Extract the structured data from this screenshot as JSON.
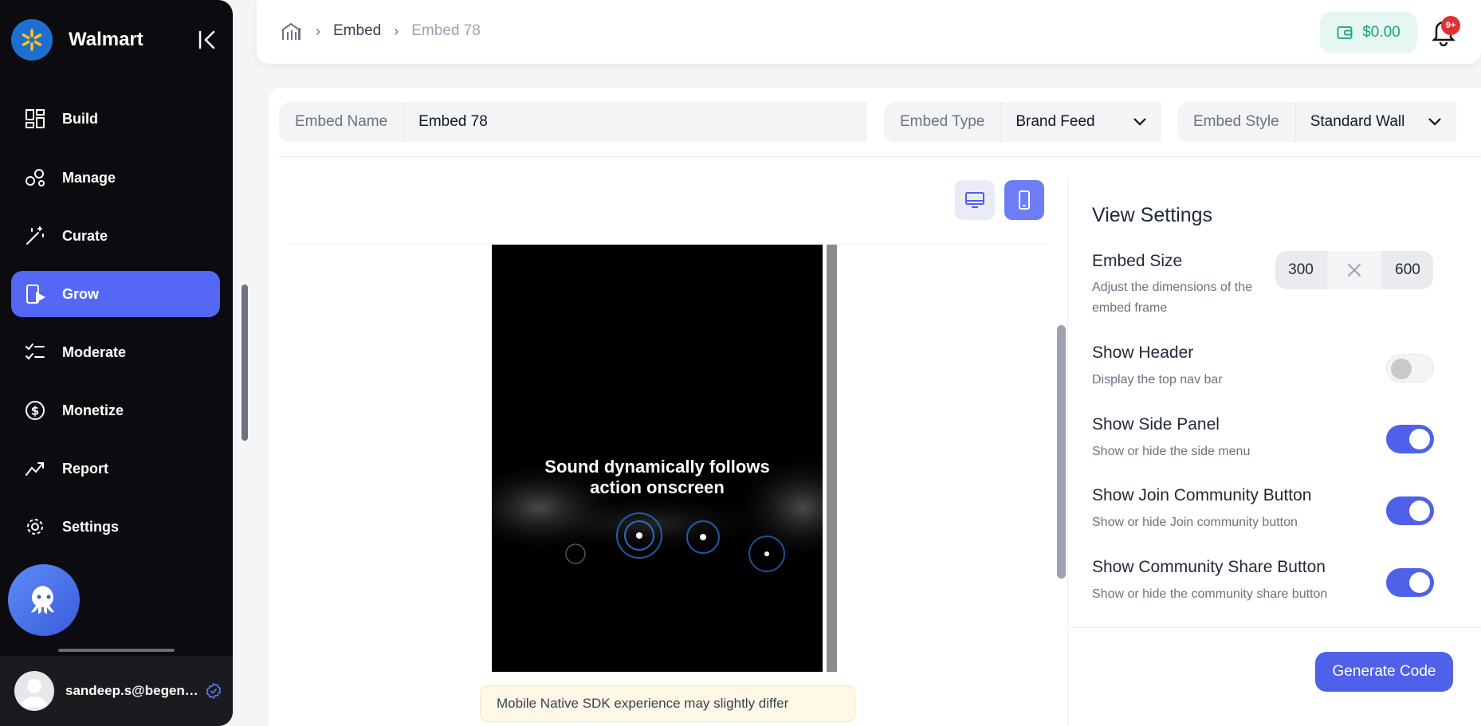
{
  "sidebar": {
    "brand": "Walmart",
    "items": [
      {
        "label": "Build",
        "icon": "grid-icon"
      },
      {
        "label": "Manage",
        "icon": "bubbles-icon"
      },
      {
        "label": "Curate",
        "icon": "magic-wand-icon"
      },
      {
        "label": "Grow",
        "icon": "mobile-play-icon",
        "active": true
      },
      {
        "label": "Moderate",
        "icon": "checklist-icon"
      },
      {
        "label": "Monetize",
        "icon": "dollar-icon"
      },
      {
        "label": "Report",
        "icon": "trend-icon"
      },
      {
        "label": "Settings",
        "icon": "gear-icon"
      }
    ],
    "user_email": "sandeep.s@begenuin.com"
  },
  "header": {
    "breadcrumb": [
      "Embed",
      "Embed 78"
    ],
    "wallet": "$0.00",
    "notifications_badge": "9+"
  },
  "form": {
    "embed_name_label": "Embed Name",
    "embed_name_value": "Embed 78",
    "embed_type_label": "Embed Type",
    "embed_type_value": "Brand Feed",
    "embed_style_label": "Embed Style",
    "embed_style_value": "Standard Wall"
  },
  "preview": {
    "caption_line1": "Sound dynamically follows",
    "caption_line2": "action onscreen",
    "notice": "Mobile Native SDK experience may slightly differ"
  },
  "settings": {
    "title": "View Settings",
    "embed_size": {
      "title": "Embed Size",
      "desc": "Adjust the dimensions of the embed frame",
      "width": "300",
      "height": "600"
    },
    "show_header": {
      "title": "Show Header",
      "desc": "Display the top nav bar",
      "on": false
    },
    "show_side_panel": {
      "title": "Show Side Panel",
      "desc": "Show or hide the side menu",
      "on": true
    },
    "show_join": {
      "title": "Show Join Community Button",
      "desc": "Show or hide Join community button",
      "on": true
    },
    "show_share": {
      "title": "Show Community Share Button",
      "desc": "Show or hide the community share button",
      "on": true
    },
    "generate_button": "Generate Code"
  },
  "colors": {
    "accent": "#4f60e9",
    "sidebar_bg": "#0b0b10",
    "wallet_green": "#1aa37a"
  }
}
